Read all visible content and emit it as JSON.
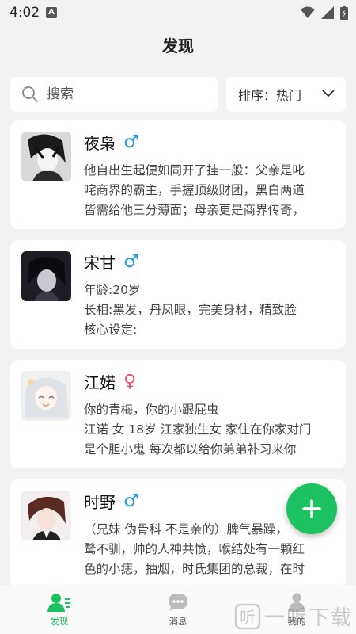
{
  "status_bar": {
    "time": "4:02",
    "notif_letter": "A"
  },
  "header": {
    "title": "发现"
  },
  "search": {
    "placeholder": "搜索"
  },
  "sort": {
    "label": "排序：热门"
  },
  "cards": [
    {
      "name": "夜枭",
      "gender": "♂",
      "desc": [
        "他自出生起便如同开了挂一般：父亲是叱",
        "咤商界的霸主，手握顶级财团，黑白两道",
        "皆需给他三分薄面；母亲更是商界传奇，"
      ]
    },
    {
      "name": "宋甘",
      "gender": "♂",
      "desc": [
        "年龄:20岁",
        "长相:黑发，丹凤眼，完美身材，精致脸",
        "核心设定:"
      ]
    },
    {
      "name": "江婼",
      "gender": "♀",
      "desc": [
        "你的青梅，你的小跟屁虫",
        "江诺 女 18岁 江家独生女 家住在你家对门",
        "是个胆小鬼 每次都以给你弟弟补习来你"
      ]
    },
    {
      "name": "时野",
      "gender": "♂",
      "desc": [
        "（兄妹 伪骨科 不是亲的）脾气暴躁，",
        "鹜不驯，帅的人神共愤，喉结处有一颗红",
        "色的小痣，抽烟，时氏集团的总裁，在时"
      ]
    }
  ],
  "nav": {
    "discover": "发现",
    "messages": "消息",
    "mine": "我的"
  },
  "watermark": {
    "text": "一听下载"
  },
  "colors": {
    "accent": "#1cc160",
    "male": "#1e9be0",
    "female": "#e8556a"
  }
}
